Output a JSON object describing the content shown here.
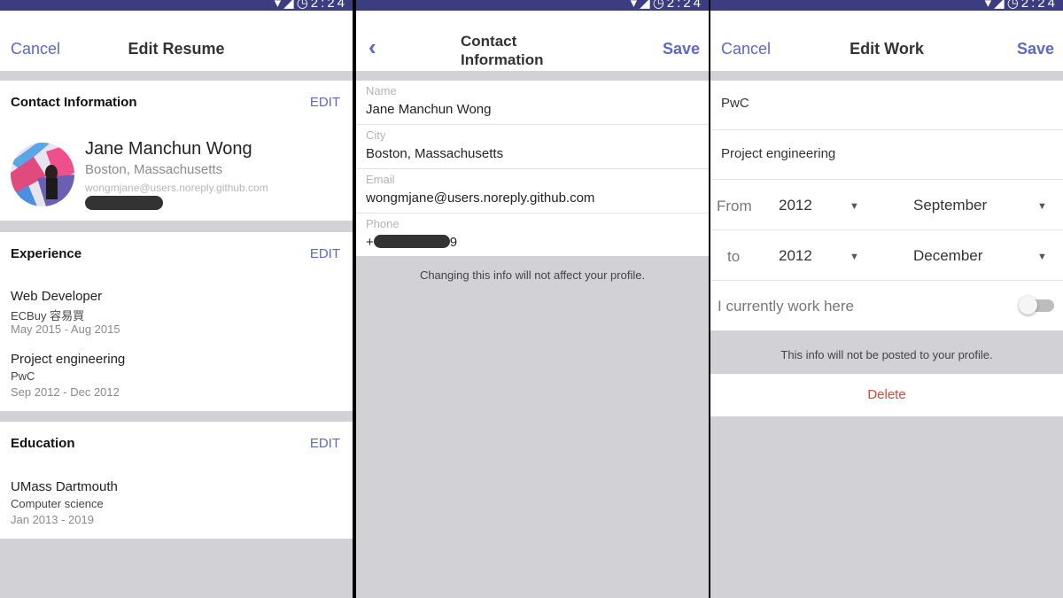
{
  "status_bar": {
    "time": "2:24"
  },
  "screen1": {
    "nav": {
      "cancel": "Cancel",
      "title": "Edit Resume"
    },
    "contact": {
      "heading": "Contact Information",
      "edit": "EDIT",
      "name": "Jane Manchun Wong",
      "city": "Boston, Massachusetts",
      "email": "wongmjane@users.noreply.github.com"
    },
    "experience": {
      "heading": "Experience",
      "edit": "EDIT",
      "items": [
        {
          "title": "Web Developer",
          "company": "ECBuy 容易買",
          "dates": "May 2015 - Aug 2015"
        },
        {
          "title": "Project engineering",
          "company": "PwC",
          "dates": "Sep 2012 - Dec 2012"
        }
      ]
    },
    "education": {
      "heading": "Education",
      "edit": "EDIT",
      "items": [
        {
          "school": "UMass Dartmouth",
          "field": "Computer science",
          "dates": "Jan 2013 - 2019"
        }
      ]
    }
  },
  "screen2": {
    "nav": {
      "title": "Contact Information",
      "save": "Save"
    },
    "fields": [
      {
        "label": "Name",
        "value": "Jane Manchun Wong"
      },
      {
        "label": "City",
        "value": "Boston, Massachusetts"
      },
      {
        "label": "Email",
        "value": "wongmjane@users.noreply.github.com"
      },
      {
        "label": "Phone",
        "prefix": "+",
        "suffix": "9"
      }
    ],
    "footnote": "Changing this info will not affect your profile."
  },
  "screen3": {
    "nav": {
      "cancel": "Cancel",
      "title": "Edit Work",
      "save": "Save"
    },
    "company": "PwC",
    "position": "Project engineering",
    "from": {
      "label": "From",
      "year": "2012",
      "month": "September"
    },
    "to": {
      "label": "to",
      "year": "2012",
      "month": "December"
    },
    "current_label": "I currently work here",
    "current_on": false,
    "footnote": "This info will not be posted to your profile.",
    "delete": "Delete"
  },
  "colors": {
    "accent": "#5c67c6",
    "status_bar": "#3b3d80",
    "background": "#d2d1d6",
    "danger": "#d9443b"
  },
  "icons": [
    "wifi-icon",
    "signal-icon",
    "alarm-icon",
    "back-chevron-icon",
    "caret-down-icon"
  ]
}
